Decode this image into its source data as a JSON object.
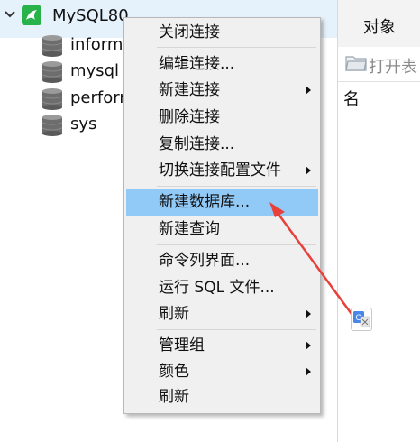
{
  "tree": {
    "connection": {
      "label": "MySQL80"
    },
    "databases": [
      {
        "label": "inform"
      },
      {
        "label": "mysql"
      },
      {
        "label": "perforr"
      },
      {
        "label": "sys"
      }
    ]
  },
  "right_panel": {
    "tab_label": "对象",
    "open_table_label": "打开表",
    "column_header": "名"
  },
  "context_menu": {
    "items": [
      {
        "label": "关闭连接",
        "submenu": false
      },
      {
        "label": "编辑连接...",
        "submenu": false
      },
      {
        "label": "新建连接",
        "submenu": true
      },
      {
        "label": "删除连接",
        "submenu": false
      },
      {
        "label": "复制连接...",
        "submenu": false
      },
      {
        "label": "切换连接配置文件",
        "submenu": true
      },
      {
        "label": "新建数据库...",
        "submenu": false,
        "highlighted": true
      },
      {
        "label": "新建查询",
        "submenu": false
      },
      {
        "label": "命令列界面...",
        "submenu": false
      },
      {
        "label": "运行 SQL 文件...",
        "submenu": false
      },
      {
        "label": "刷新",
        "submenu": true
      },
      {
        "label": "管理组",
        "submenu": true
      },
      {
        "label": "颜色",
        "submenu": true
      },
      {
        "label": "刷新",
        "submenu": false
      }
    ]
  },
  "colors": {
    "highlight": "#91c9f7",
    "selected_row": "#e5f1fb",
    "connection_icon": "#27b24a",
    "annotation_arrow": "#e8413c"
  },
  "icons": {
    "connection": "dolphin-icon",
    "database": "database-icon",
    "open_table": "folder-icon",
    "expand": "chevron-down-icon",
    "translate": "google-translate-icon"
  }
}
